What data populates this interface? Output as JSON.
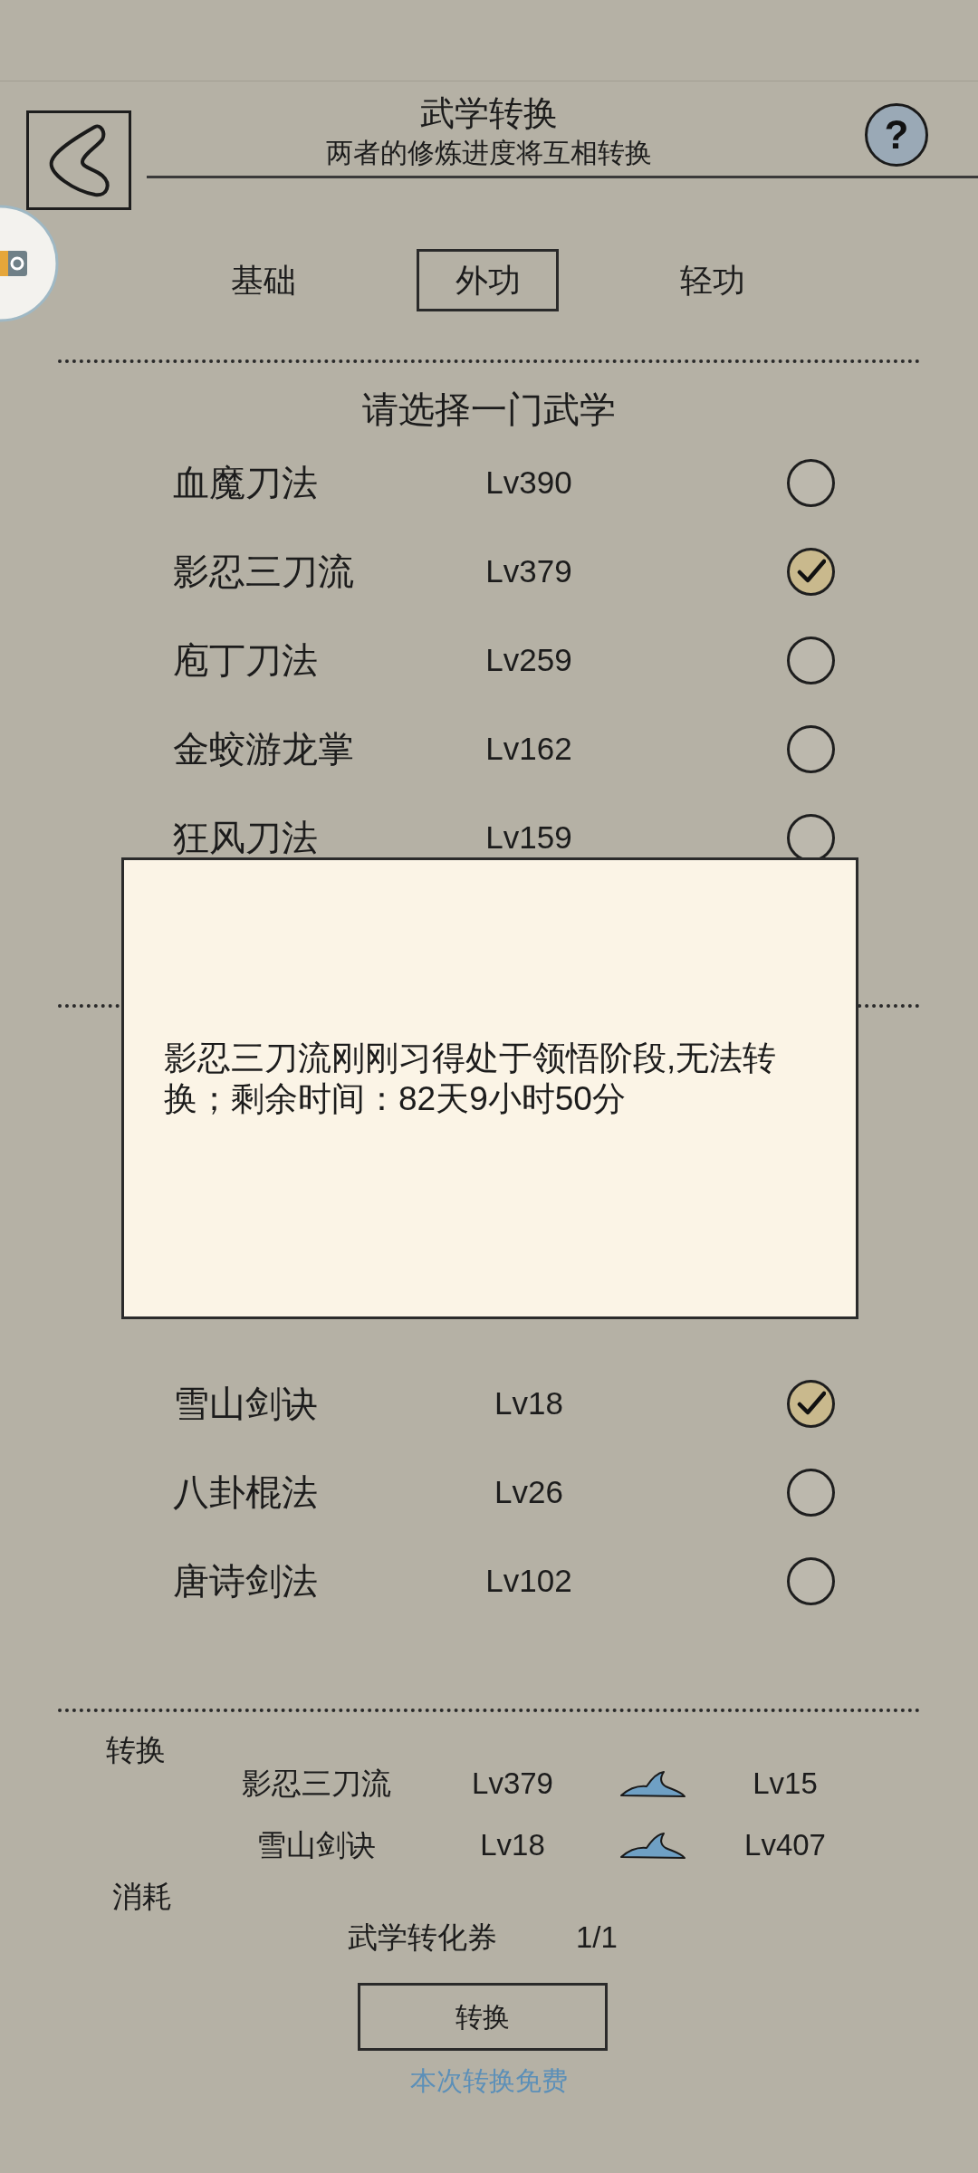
{
  "header": {
    "title": "武学转换",
    "subtitle": "两者的修炼进度将互相转换",
    "help": "?"
  },
  "tabs": [
    {
      "label": "基础",
      "selected": false
    },
    {
      "label": "外功",
      "selected": true
    },
    {
      "label": "轻功",
      "selected": false
    }
  ],
  "skill_list": {
    "heading": "请选择一门武学",
    "rows": [
      {
        "name": "血魔刀法",
        "lv": "Lv390",
        "selected": false
      },
      {
        "name": "影忍三刀流",
        "lv": "Lv379",
        "selected": true
      },
      {
        "name": "庖丁刀法",
        "lv": "Lv259",
        "selected": false
      },
      {
        "name": "金蛟游龙掌",
        "lv": "Lv162",
        "selected": false
      },
      {
        "name": "狂风刀法",
        "lv": "Lv159",
        "selected": false
      }
    ]
  },
  "second_list": {
    "rows": [
      {
        "name": "雪山剑诀",
        "lv": "Lv18",
        "selected": true
      },
      {
        "name": "八卦棍法",
        "lv": "Lv26",
        "selected": false
      },
      {
        "name": "唐诗剑法",
        "lv": "Lv102",
        "selected": false
      }
    ]
  },
  "dialog": {
    "message": "影忍三刀流刚刚习得处于领悟阶段,无法转换；剩余时间：82天9小时50分"
  },
  "conversion": {
    "label": "转换",
    "pairs": [
      {
        "name": "影忍三刀流",
        "lv_before": "Lv379",
        "lv_after": "Lv15"
      },
      {
        "name": "雪山剑诀",
        "lv_before": "Lv18",
        "lv_after": "Lv407"
      }
    ]
  },
  "cost": {
    "label": "消耗",
    "item": "武学转化券",
    "count": "1/1"
  },
  "convert_button": {
    "label": "转换"
  },
  "note": "本次转换免费"
}
